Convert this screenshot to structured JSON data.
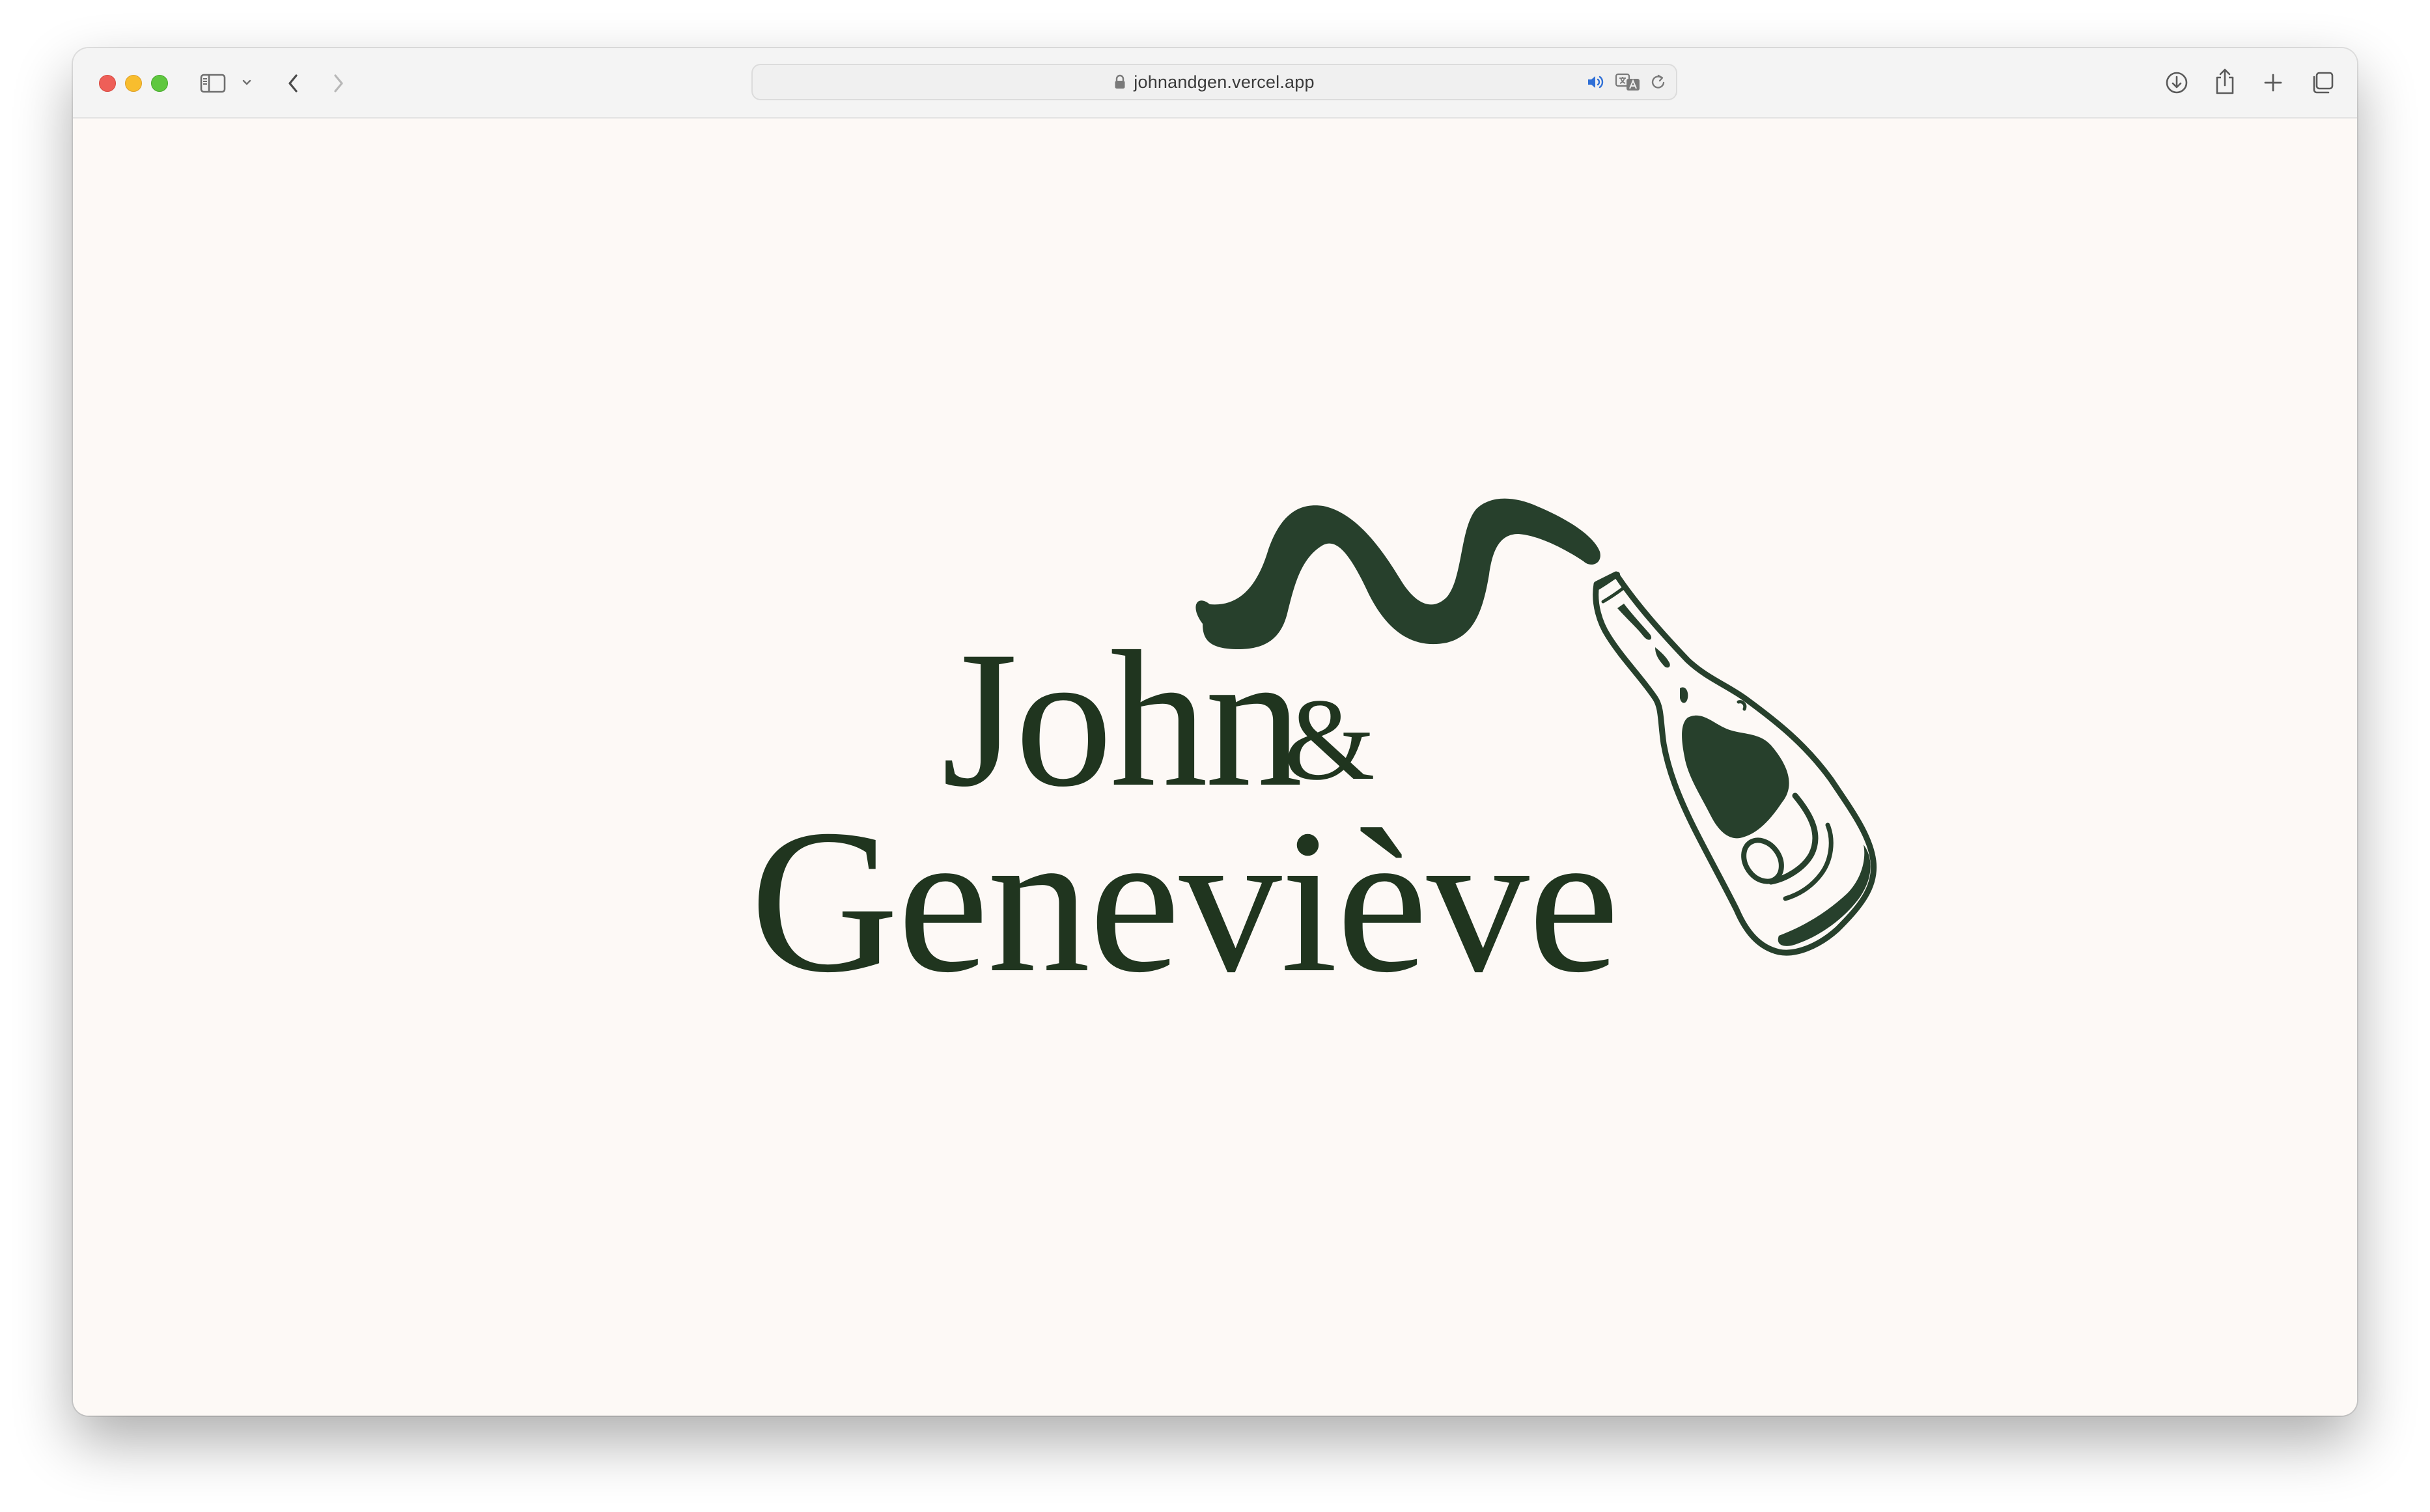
{
  "browser": {
    "url": "johnandgen.vercel.app",
    "icons": {
      "sidebar": "sidebar-icon",
      "chevron": "chevron-down-icon",
      "back": "back-arrow-icon",
      "forward": "forward-arrow-icon",
      "lock": "lock-icon",
      "audio": "speaker-icon",
      "translate": "translate-icon",
      "reload": "reload-icon",
      "download": "download-icon",
      "share": "share-icon",
      "new_tab": "plus-icon",
      "tabs": "tab-overview-icon"
    }
  },
  "page": {
    "title_line1": "John",
    "ampersand": "&",
    "title_line2": "Geneviève",
    "illustration": "champagne-bottle-pouring-icon"
  },
  "colors": {
    "background": "#fdf9f6",
    "ink": "#20351f",
    "accent_audio": "#2f6fd6"
  }
}
